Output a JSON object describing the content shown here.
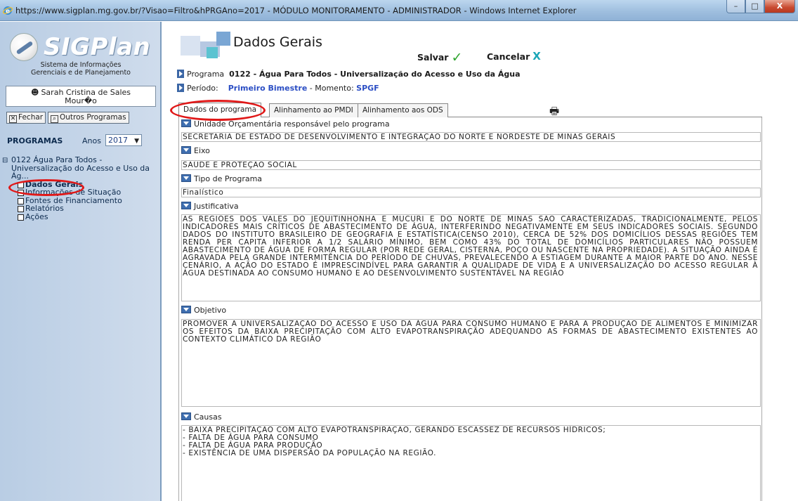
{
  "window": {
    "title": "https://www.sigplan.mg.gov.br/?Visao=Filtro&hPRGAno=2017 - MÓDULO MONITORAMENTO - ADMINISTRADOR - Windows Internet Explorer",
    "minimize": "–",
    "maximize": "□",
    "close": "X"
  },
  "sidebar": {
    "logo_text": "SIGPlan",
    "subtitle_line1": "Sistema de Informações",
    "subtitle_line2": "Gerenciais e de Planejamento",
    "user_line1": "Sarah Cristina de Sales",
    "user_line2": "Mour�o",
    "fechar_label": "Fechar",
    "outros_label": "Outros Programas",
    "programas_label": "PROGRAMAS",
    "anos_label": "Anos",
    "year_value": "2017",
    "program_name": "0122 Água Para Todos - Universalização do Acesso e Uso da Ág...",
    "items": [
      {
        "label": "Dados Gerais"
      },
      {
        "label": "Informações de Situação"
      },
      {
        "label": "Fontes de Financiamento"
      },
      {
        "label": "Relatórios"
      },
      {
        "label": "Ações"
      }
    ]
  },
  "header": {
    "title": "Dados Gerais",
    "salvar": "Salvar",
    "salvar_mark": "✓",
    "cancelar": "Cancelar",
    "cancelar_mark": "X",
    "programa_label": "Programa",
    "programa_value": "0122 - Água Para Todos - Universalização do Acesso e Uso da Água",
    "periodo_label": "Período:",
    "periodo_value": "Primeiro Bimestre",
    "momento_label": "- Momento:",
    "momento_value": "SPGF"
  },
  "tabs": [
    {
      "label": "Dados do programa"
    },
    {
      "label": "Alinhamento ao PMDI"
    },
    {
      "label": "Alinhamento aos ODS"
    }
  ],
  "sections": {
    "unidade": {
      "label": "Unidade Orçamentária responsável pelo programa",
      "value": "SECRETARIA DE ESTADO DE DESENVOLVIMENTO E INTEGRAÇÃO DO NORTE E NORDESTE DE MINAS GERAIS"
    },
    "eixo": {
      "label": "Eixo",
      "value": "SAÚDE E PROTEÇÃO SOCIAL"
    },
    "tipo": {
      "label": "Tipo de Programa",
      "value": "Finalístico"
    },
    "justificativa": {
      "label": "Justificativa",
      "lines": [
        "AS REGIÕES DOS VALES DO JEQUITINHONHA E MUCURI E DO NORTE DE MINAS SÃO CARACTERIZADAS, TRADICIONALMENTE, PELOS",
        "INDICADORES MAIS CRÍTICOS DE ABASTECIMENTO DE ÁGUA, INTERFERINDO NEGATIVAMENTE EM SEUS INDICADORES SOCIAIS. SEGUNDO",
        "DADOS DO INSTITUTO BRASILEIRO DE GEOGRAFIA E ESTATÍSTICA(CENSO 2010), CERCA DE 52% DOS DOMICÍLIOS DESSAS REGIÕES TEM",
        "RENDA PER CAPITA INFERIOR A 1/2 SALÁRIO MÍNIMO, BEM COMO 43% DO TOTAL DE DOMICÍLIOS PARTICULARES NÃO POSSUEM",
        "ABASTECIMENTO DE ÁGUA DE FORMA REGULAR (POR REDE GERAL, CISTERNA, POÇO OU NASCENTE NA PROPRIEDADE). A SITUAÇÃO AINDA É",
        "AGRAVADA PELA GRANDE INTERMITÊNCIA DO PERÍODO DE CHUVAS, PREVALECENDO A ESTIAGEM DURANTE A MAIOR PARTE DO ANO. NESSE",
        "CENÁRIO, A AÇÃO DO ESTADO É IMPRESCINDÍVEL PARA GARANTIR A QUALIDADE DE VIDA E A UNIVERSALIZAÇÃO DO ACESSO REGULAR À",
        "ÁGUA DESTINADA AO CONSUMO HUMANO E AO DESENVOLVIMENTO SUSTENTÁVEL NA REGIÃO"
      ]
    },
    "objetivo": {
      "label": "Objetivo",
      "lines": [
        "PROMOVER A UNIVERSALIZAÇÃO DO ACESSO E USO DA ÁGUA PARA CONSUMO HUMANO E PARA A PRODUÇÃO DE ALIMENTOS E MINIMIZAR",
        "OS EFEITOS DA BAIXA PRECIPITAÇÃO COM ALTO EVAPOTRANSPIRAÇÃO ADEQUANDO AS FORMAS DE ABASTECIMENTO EXISTENTES AO",
        "CONTEXTO CLIMÁTICO DA REGIÃO"
      ]
    },
    "causas": {
      "label": "Causas",
      "lines": [
        "- BAIXA PRECIPITAÇÃO COM ALTO EVAPOTRANSPIRAÇÃO, GERANDO ESCASSEZ DE RECURSOS HÍDRICOS;",
        "- FALTA DE ÁGUA PARA CONSUMO",
        "- FALTA DE ÁGUA PARA PRODUÇÃO",
        "- EXISTÊNCIA DE UMA DISPERSÃO DA POPULAÇÃO NA REGIÃO."
      ]
    }
  },
  "colors": {
    "sidebar_bg": "#c4d6ea",
    "accent_blue": "#3f6fb0",
    "highlight_red": "#e01818",
    "salvar_green": "#2fa52f",
    "cancelar_teal": "#1aa6b7"
  }
}
